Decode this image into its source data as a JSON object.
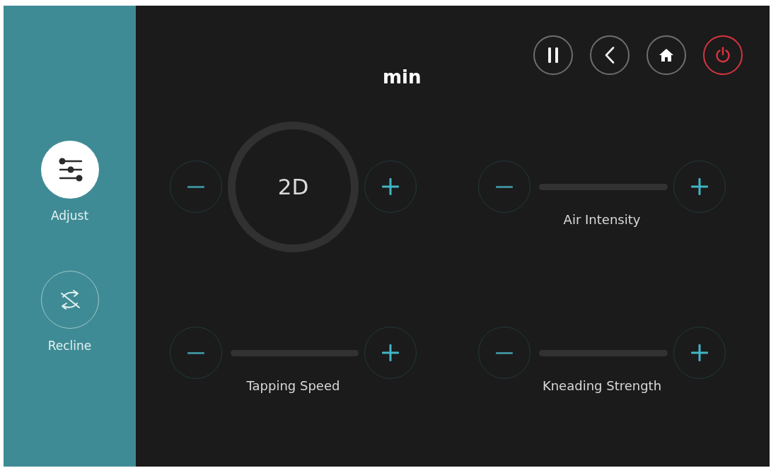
{
  "sidebar": {
    "items": [
      {
        "label": "Adjust",
        "selected": true
      },
      {
        "label": "Recline",
        "selected": false
      }
    ]
  },
  "title": "min",
  "controls": [
    {
      "kind": "mode",
      "value": "2D"
    },
    {
      "kind": "slider",
      "label": "Air Intensity",
      "level": 0
    },
    {
      "kind": "slider",
      "label": "Tapping Speed",
      "level": 0
    },
    {
      "kind": "slider",
      "label": "Kneading Strength",
      "level": 0
    }
  ]
}
